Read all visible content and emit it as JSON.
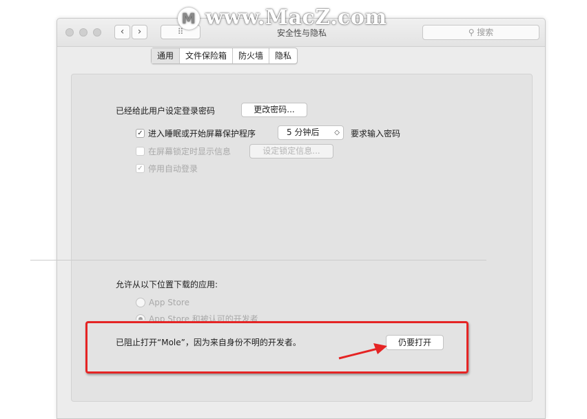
{
  "watermark": {
    "logo_glyph": "M",
    "text": "www.MacZ.com"
  },
  "window": {
    "title": "安全性与隐私",
    "nav": {
      "back": "‹",
      "forward": "›",
      "grid": "⠿"
    },
    "search_placeholder": "搜索"
  },
  "tabs": [
    {
      "label": "通用",
      "selected": true
    },
    {
      "label": "文件保险箱",
      "selected": false
    },
    {
      "label": "防火墙",
      "selected": false
    },
    {
      "label": "隐私",
      "selected": false
    }
  ],
  "general": {
    "password_label": "已经给此用户设定登录密码",
    "change_password_button": "更改密码...",
    "require_password": {
      "checked": true,
      "label_before": "进入睡眠或开始屏幕保护程序",
      "delay_value": "5 分钟后",
      "label_after": "要求输入密码"
    },
    "show_message": {
      "checked": false,
      "label": "在屏幕锁定时显示信息",
      "button": "设定锁定信息..."
    },
    "disable_auto_login": {
      "checked": true,
      "label": "停用自动登录"
    }
  },
  "downloads": {
    "heading": "允许从以下位置下载的应用:",
    "options": [
      {
        "label": "App Store",
        "selected": false
      },
      {
        "label": "App Store 和被认可的开发者",
        "selected": true
      }
    ],
    "blocked_message": "已阻止打开“Mole”，因为来自身份不明的开发者。",
    "open_anyway_button": "仍要打开"
  },
  "colors": {
    "highlight_red": "#e52424",
    "window_bg": "#ececec",
    "panel_bg": "#e3e3e3"
  }
}
